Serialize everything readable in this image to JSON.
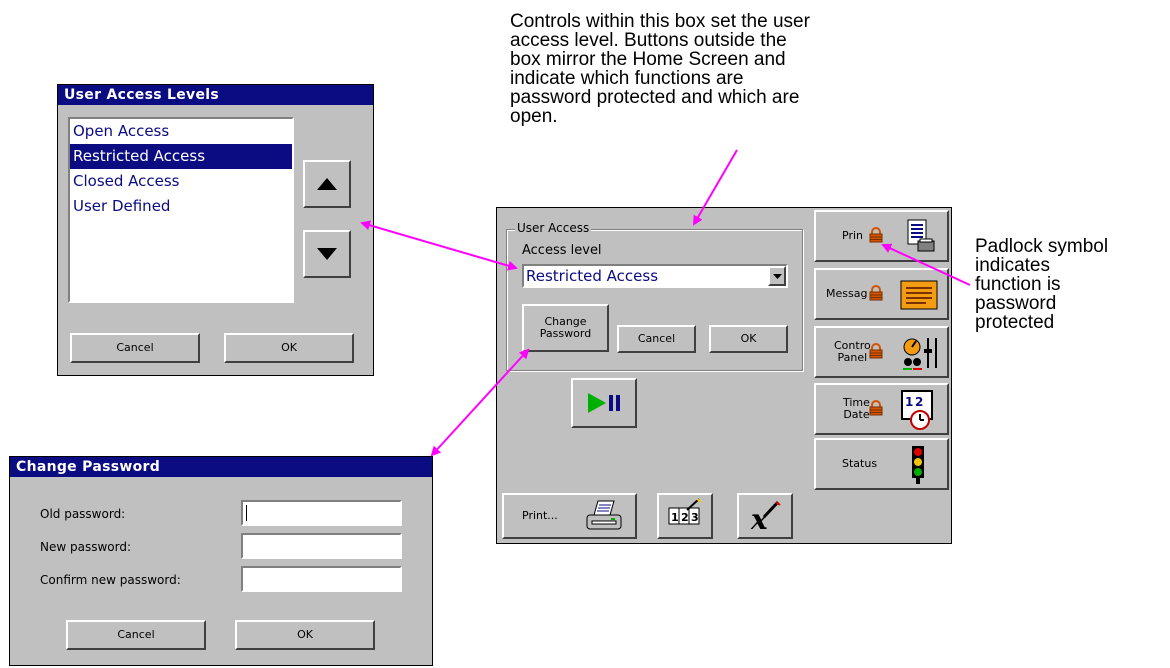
{
  "annotation_top": "Controls within this box set the user access level. Buttons outside the box mirror the Home Screen and indicate which functions are password protected and which are open.",
  "annotation_top_lines": [
    "Controls within this box set the user",
    "access level. Buttons outside the",
    "box mirror the Home Screen and",
    "indicate which functions are",
    "password protected and which are",
    "open."
  ],
  "annotation_right_lines": [
    "Padlock symbol",
    "indicates",
    "function is",
    "password",
    "protected"
  ],
  "access_levels_dialog": {
    "title": "User Access Levels",
    "items": [
      "Open Access",
      "Restricted Access",
      "Closed Access",
      "User Defined"
    ],
    "selected_index": 1,
    "cancel_label": "Cancel",
    "ok_label": "OK"
  },
  "change_password_dialog": {
    "title": "Change Password",
    "old_label": "Old password:",
    "new_label": "New password:",
    "confirm_label": "Confirm new password:",
    "old_value": "",
    "new_value": "",
    "confirm_value": "",
    "cancel_label": "Cancel",
    "ok_label": "OK"
  },
  "home_panel": {
    "group_title": "User Access",
    "access_level_label": "Access level",
    "access_level_value": "Restricted Access",
    "change_password_label_1": "Change",
    "change_password_label_2": "Password",
    "cancel_label": "Cancel",
    "ok_label": "OK",
    "side_buttons": {
      "print": "Prin",
      "message": "Messag",
      "control_panel_1": "Contro",
      "control_panel_2": "Panel",
      "time_date_1": "Time",
      "time_date_2": "Date",
      "status": "Status"
    },
    "print_button_label": "Print...",
    "calc_digits": [
      "1",
      "2",
      "3"
    ]
  },
  "colors": {
    "title_bar": "#0b0b82",
    "dialog_bg": "#c0c0c0",
    "arrow": "#ff00ff",
    "padlock": "#d35400",
    "play": "#00b000"
  }
}
